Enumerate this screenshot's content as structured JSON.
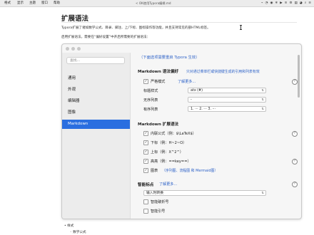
{
  "menubar": {
    "apple": "",
    "items": [
      "格式",
      "显示",
      "主题",
      "窗口",
      "帮助"
    ],
    "doc_title": "< OK使用Typora编辑.md",
    "tray": [
      "⌁",
      "◔",
      "◉",
      "❄",
      "▶",
      "≋",
      "⚙",
      "▤",
      "◕",
      "⌕",
      "≡"
    ]
  },
  "doc": {
    "heading": "扩展语法",
    "para1": "Typora扩展了诸如数学公式、目录、脚注、上/下标、图标操作等功能，并且支持常见的部HTML标签。",
    "para2": "启用扩展语法，需要在“偏好设置”中开启所需要的扩展语法："
  },
  "prefs": {
    "search_placeholder": "查找...",
    "nav": [
      "通用",
      "外观",
      "编辑器",
      "图像",
      "Markdown"
    ],
    "notice": "（下面选项需要重启 Typora 生效）",
    "md_pref": {
      "title": "Markdown 语法偏好",
      "note": "只对通过菜单栏或快捷键生成的引用和列表有效",
      "strict_label": "严格模式",
      "strict_link": "了解更多...",
      "heading_label": "标题样式",
      "heading_value": "atx (#)",
      "ul_label": "无序列表",
      "ul_value": "-",
      "ol_label": "有序列表",
      "ol_value": "1.  ···  2.  ···  3.  ···"
    },
    "md_ext": {
      "title": "Markdown 扩展语法",
      "items": [
        {
          "label": "内联公式（例：$\\LaTeX$）"
        },
        {
          "label": "下标（例：H~2~O）"
        },
        {
          "label": "上标（例：X^2^）"
        },
        {
          "label": "高亮（例：==key==）"
        },
        {
          "label": "图表",
          "extra": "（序列图、流程图 和 Mermaid图）"
        }
      ]
    },
    "smart": {
      "title": "智能标点",
      "link": "了解更多...",
      "select_value": "输入时转换",
      "items": [
        {
          "label": "智能破折号",
          "checked": false
        },
        {
          "label": "智能引号",
          "checked": false
        }
      ]
    }
  },
  "below": {
    "bullet1": "• 样式",
    "bullet2": "◦ 数学公式"
  }
}
